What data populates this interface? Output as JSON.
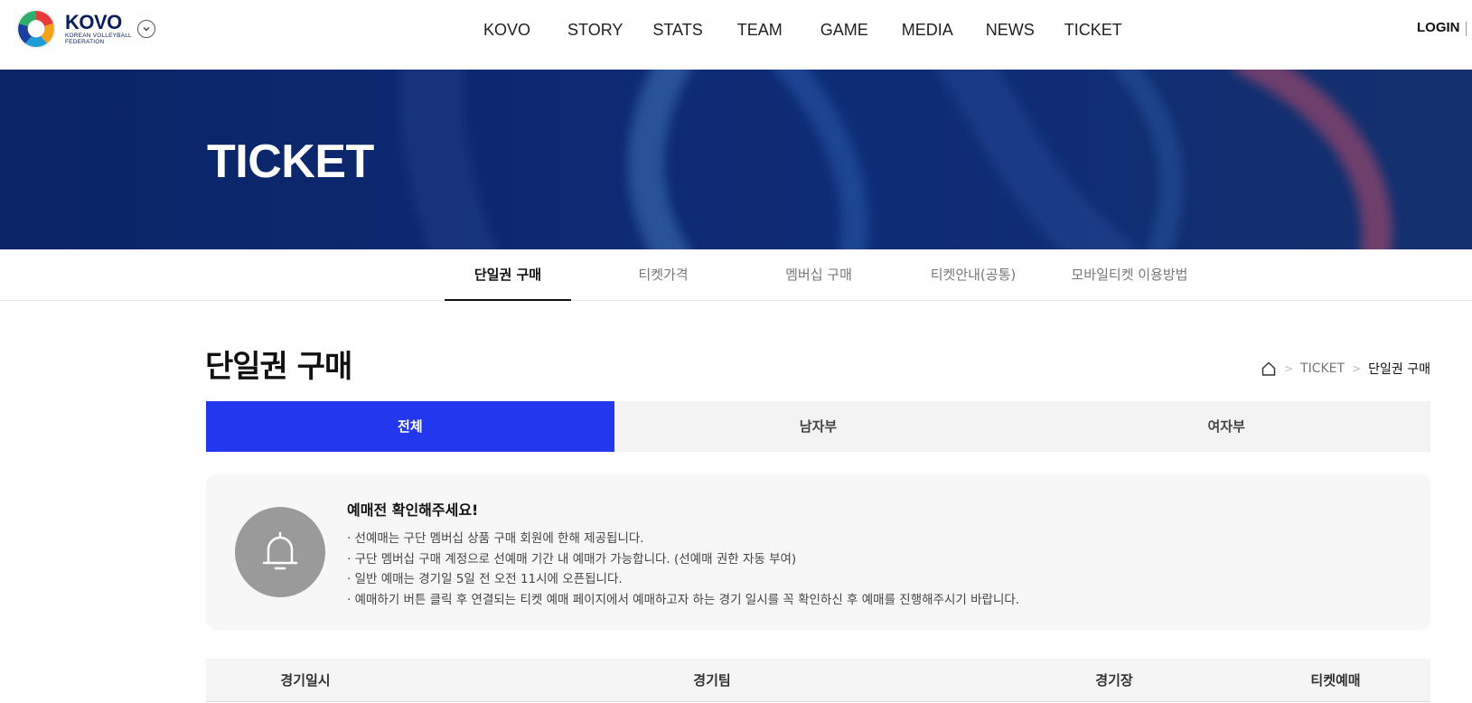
{
  "header": {
    "logo": {
      "word": "KOVO",
      "sub_line1": "KOREAN VOLLEYBALL",
      "sub_line2": "FEDERATION"
    },
    "nav": [
      "KOVO",
      "STORY",
      "STATS",
      "TEAM",
      "GAME",
      "MEDIA",
      "NEWS",
      "TICKET"
    ],
    "login_label": "LOGIN"
  },
  "hero": {
    "title": "TICKET"
  },
  "subtabs": [
    {
      "label": "단일권 구매",
      "active": true
    },
    {
      "label": "티켓가격",
      "active": false
    },
    {
      "label": "멤버십 구매",
      "active": false
    },
    {
      "label": "티켓안내(공통)",
      "active": false
    },
    {
      "label": "모바일티켓 이용방법",
      "active": false
    }
  ],
  "page": {
    "title": "단일권 구매",
    "breadcrumb": {
      "section": "TICKET",
      "current": "단일권 구매"
    }
  },
  "category_tabs": [
    {
      "label": "전체",
      "active": true
    },
    {
      "label": "남자부",
      "active": false
    },
    {
      "label": "여자부",
      "active": false
    }
  ],
  "notice": {
    "title": "예매전 확인해주세요!",
    "items": [
      "· 선예매는 구단 멤버십 상품 구매 회원에 한해 제공됩니다.",
      "· 구단 멤버십 구매 계정으로 선예매 기간 내 예매가 가능합니다. (선예매 권한 자동 부여)",
      "· 일반 예매는 경기일 5일 전 오전 11시에 오픈됩니다.",
      "· 예매하기 버튼 클릭 후 연결되는 티켓 예매 페이지에서 예매하고자 하는 경기 일시를 꼭 확인하신 후 예매를 진행해주시기 바랍니다."
    ]
  },
  "table": {
    "columns": [
      "경기일시",
      "경기팀",
      "경기장",
      "티켓예매"
    ]
  },
  "colors": {
    "accent": "#2337ee",
    "hero_bg": "#0d2a72",
    "brand_navy": "#0b1f5e"
  }
}
